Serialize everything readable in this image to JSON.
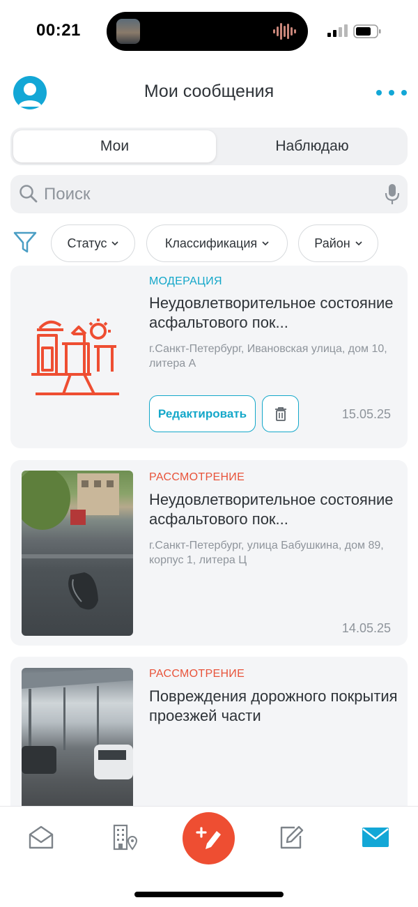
{
  "status_bar": {
    "time": "00:21"
  },
  "header": {
    "title": "Мои сообщения"
  },
  "tabs": [
    {
      "label": "Мои",
      "active": true
    },
    {
      "label": "Наблюдаю",
      "active": false
    }
  ],
  "search": {
    "placeholder": "Поиск"
  },
  "filters": [
    {
      "label": "Статус"
    },
    {
      "label": "Классификация"
    },
    {
      "label": "Район"
    }
  ],
  "messages": [
    {
      "status": "МОДЕРАЦИЯ",
      "status_color": "#13a7c9",
      "title": "Неудовлетворительное состояние асфальтового пок...",
      "address": "г.Санкт-Петербург, Ивановская улица, дом 10, литера А",
      "edit_label": "Редактировать",
      "date": "15.05.25",
      "thumbnail": "playground-illustration-icon"
    },
    {
      "status": "РАССМОТРЕНИЕ",
      "status_color": "#e8533a",
      "title": "Неудовлетворительное состояние асфальтового пок...",
      "address": "г.Санкт-Петербург, улица Бабушкина, дом 89, корпус 1, литера Ц",
      "date": "14.05.25",
      "thumbnail": "pothole-photo"
    },
    {
      "status": "РАССМОТРЕНИЕ",
      "status_color": "#e8533a",
      "title": "Повреждения дорожного покрытия  проезжей части",
      "thumbnail": "parking-road-photo"
    }
  ],
  "colors": {
    "accent": "#13a7d6",
    "fab": "#ee4e32",
    "review": "#e8533a",
    "moderation": "#13a7c9"
  },
  "tab_bar": {
    "items": [
      "home-icon",
      "buildings-location-icon",
      "create-message-fab",
      "edit-icon",
      "messages-icon"
    ],
    "active": "messages-icon"
  }
}
